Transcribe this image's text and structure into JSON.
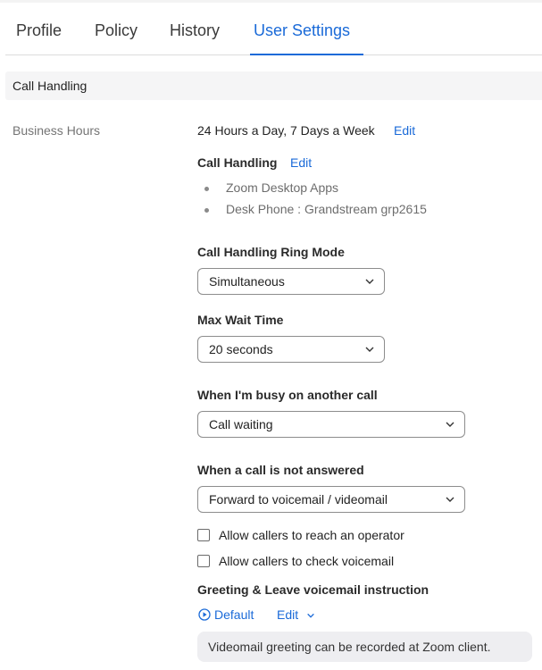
{
  "tabs": [
    {
      "label": "Profile",
      "active": false
    },
    {
      "label": "Policy",
      "active": false
    },
    {
      "label": "History",
      "active": false
    },
    {
      "label": "User Settings",
      "active": true
    }
  ],
  "section": {
    "title": "Call Handling"
  },
  "business_hours": {
    "label": "Business Hours",
    "value": "24 Hours a Day, 7 Days a Week",
    "edit_label": "Edit"
  },
  "call_handling": {
    "title": "Call Handling",
    "edit_label": "Edit",
    "devices": [
      "Zoom Desktop Apps",
      "Desk Phone : Grandstream grp2615"
    ]
  },
  "ring_mode": {
    "label": "Call Handling Ring Mode",
    "value": "Simultaneous"
  },
  "max_wait": {
    "label": "Max Wait Time",
    "value": "20 seconds"
  },
  "busy": {
    "label": "When I'm busy on another call",
    "value": "Call waiting"
  },
  "not_answered": {
    "label": "When a call is not answered",
    "value": "Forward to voicemail / videomail"
  },
  "checkboxes": [
    {
      "label": "Allow callers to reach an operator",
      "checked": false
    },
    {
      "label": "Allow callers to check voicemail",
      "checked": false
    }
  ],
  "greeting": {
    "title": "Greeting & Leave voicemail instruction",
    "default_label": "Default",
    "edit_label": "Edit",
    "note": "Videomail greeting can be recorded at Zoom client."
  },
  "colors": {
    "accent": "#1a6ad8",
    "muted": "#747474",
    "section_bg": "#f5f5f6"
  },
  "icons": {
    "play": "play-circle-icon",
    "chevron": "chevron-down-icon"
  }
}
